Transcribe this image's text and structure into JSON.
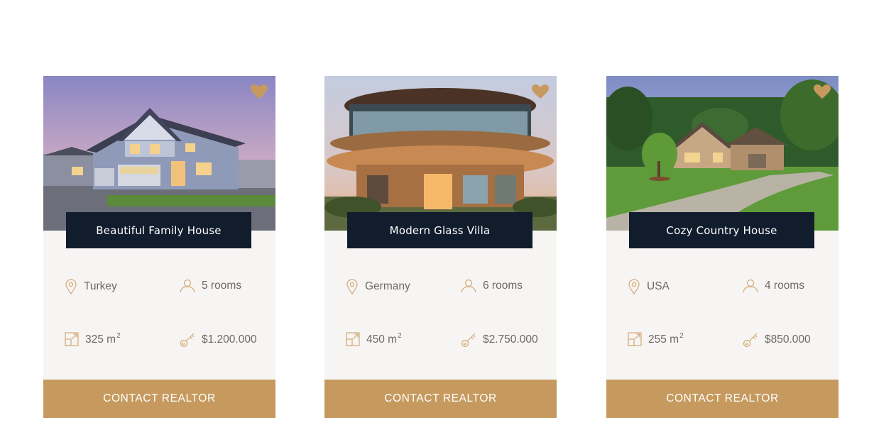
{
  "cards": [
    {
      "title": "Beautiful Family House",
      "location": "Turkey",
      "rooms": "5 rooms",
      "area": "325 m",
      "area_unit_sup": "2",
      "price": "$1.200.000",
      "cta": "CONTACT REALTOR"
    },
    {
      "title": "Modern Glass Villa",
      "location": "Germany",
      "rooms": "6 rooms",
      "area": "450 m",
      "area_unit_sup": "2",
      "price": "$2.750.000",
      "cta": "CONTACT REALTOR"
    },
    {
      "title": "Cozy Country House",
      "location": "USA",
      "rooms": "4 rooms",
      "area": "255 m",
      "area_unit_sup": "2",
      "price": "$850.000",
      "cta": "CONTACT REALTOR"
    }
  ],
  "icons": {
    "favorite": "heart-icon",
    "location": "map-pin-icon",
    "rooms": "user-icon",
    "area": "area-icon",
    "price": "key-icon"
  },
  "colors": {
    "accent": "#c69a5e",
    "title_bar": "#111c2d",
    "card_bg": "#f7f5f3",
    "text": "#6e6865"
  }
}
